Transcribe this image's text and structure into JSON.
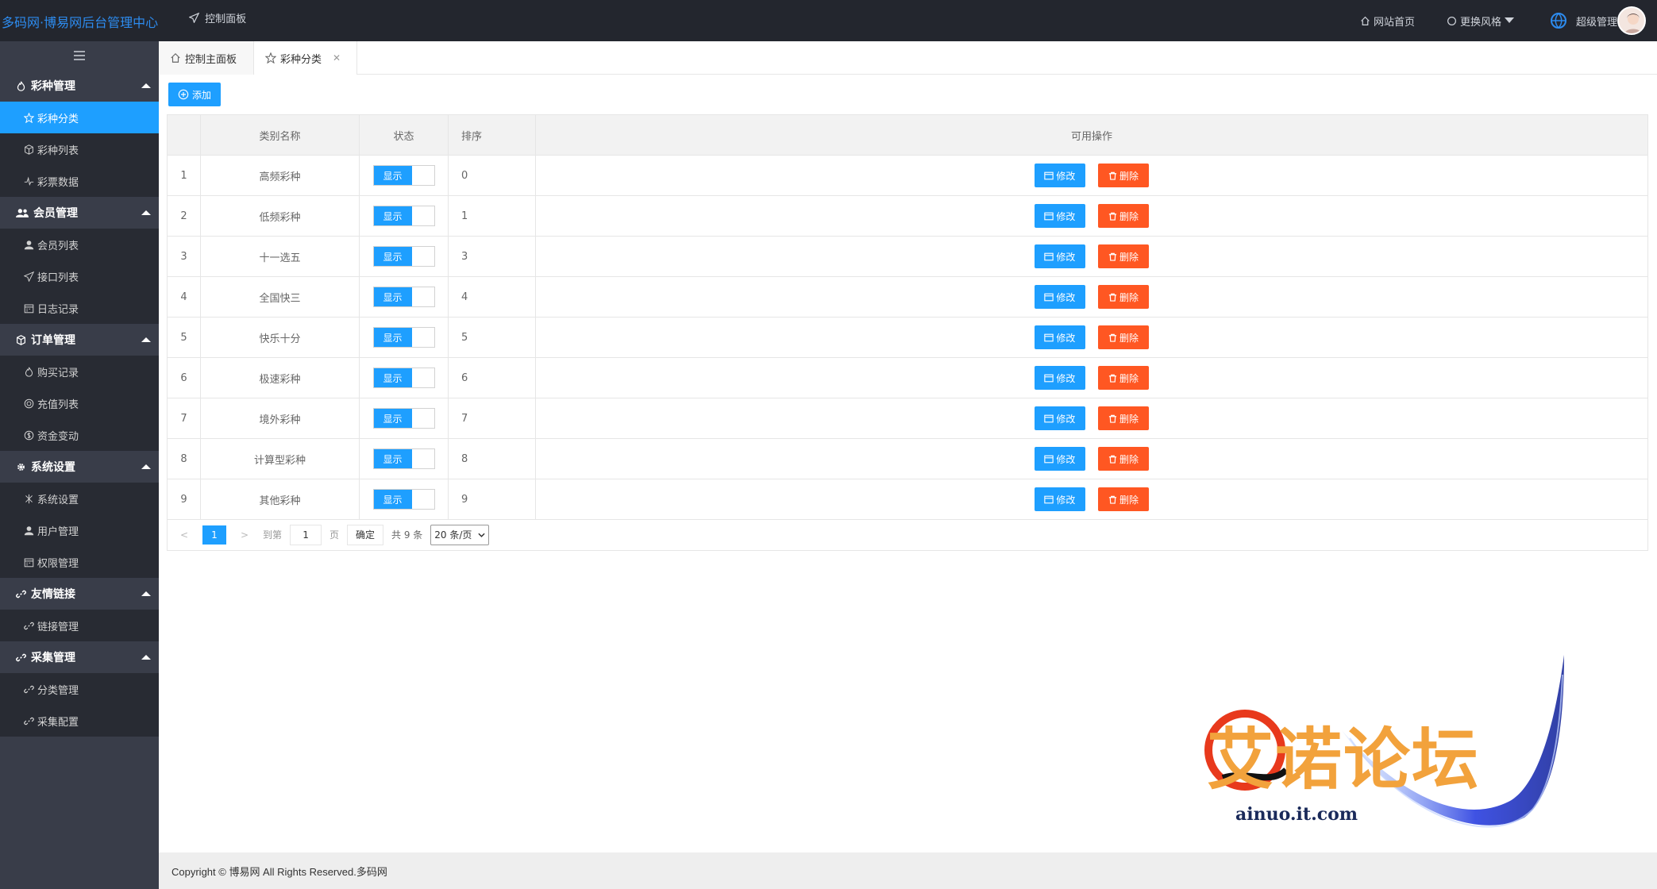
{
  "header": {
    "brand": "多码网·博易网后台管理中心",
    "control_panel": "控制面板",
    "site_home": "网站首页",
    "change_style": "更换风格",
    "admin": "超级管理"
  },
  "sidebar": {
    "groups": [
      {
        "label": "彩种管理",
        "items": [
          "彩种分类",
          "彩种列表",
          "彩票数据"
        ]
      },
      {
        "label": "会员管理",
        "items": [
          "会员列表",
          "接口列表",
          "日志记录"
        ]
      },
      {
        "label": "订单管理",
        "items": [
          "购买记录",
          "充值列表",
          "资金变动"
        ]
      },
      {
        "label": "系统设置",
        "items": [
          "系统设置",
          "用户管理",
          "权限管理"
        ]
      },
      {
        "label": "友情链接",
        "items": [
          "链接管理"
        ]
      },
      {
        "label": "采集管理",
        "items": [
          "分类管理",
          "采集配置"
        ]
      }
    ],
    "active_item": "彩种分类"
  },
  "tabs": [
    {
      "label": "控制主面板",
      "active": false
    },
    {
      "label": "彩种分类",
      "active": true
    }
  ],
  "toolbar": {
    "add_label": "添加"
  },
  "table": {
    "headers": [
      "",
      "类别名称",
      "状态",
      "排序",
      "可用操作"
    ],
    "status_label": "显示",
    "edit_label": "修改",
    "delete_label": "删除",
    "rows": [
      {
        "idx": "1",
        "name": "高频彩种",
        "sort": "0"
      },
      {
        "idx": "2",
        "name": "低频彩种",
        "sort": "1"
      },
      {
        "idx": "3",
        "name": "十一选五",
        "sort": "3"
      },
      {
        "idx": "4",
        "name": "全国快三",
        "sort": "4"
      },
      {
        "idx": "5",
        "name": "快乐十分",
        "sort": "5"
      },
      {
        "idx": "6",
        "name": "极速彩种",
        "sort": "6"
      },
      {
        "idx": "7",
        "name": "境外彩种",
        "sort": "7"
      },
      {
        "idx": "8",
        "name": "计算型彩种",
        "sort": "8"
      },
      {
        "idx": "9",
        "name": "其他彩种",
        "sort": "9"
      }
    ]
  },
  "pager": {
    "current": "1",
    "goto_label": "到第",
    "goto_value": "1",
    "page_label": "页",
    "confirm_label": "确定",
    "total": "共 9 条",
    "page_size": "20 条/页"
  },
  "footer": {
    "copyright": "Copyright © 博易网 All Rights Reserved.多码网"
  },
  "watermark": {
    "cn": "艾诺论坛",
    "url": "ainuo.it.com"
  }
}
